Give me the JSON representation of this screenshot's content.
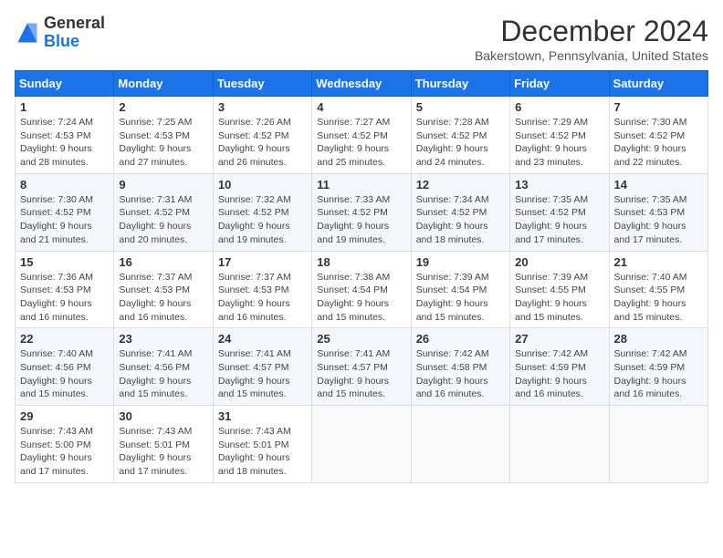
{
  "header": {
    "logo_general": "General",
    "logo_blue": "Blue",
    "title": "December 2024",
    "location": "Bakerstown, Pennsylvania, United States"
  },
  "columns": [
    "Sunday",
    "Monday",
    "Tuesday",
    "Wednesday",
    "Thursday",
    "Friday",
    "Saturday"
  ],
  "weeks": [
    [
      {
        "day": "1",
        "sunrise": "7:24 AM",
        "sunset": "4:53 PM",
        "daylight": "9 hours and 28 minutes."
      },
      {
        "day": "2",
        "sunrise": "7:25 AM",
        "sunset": "4:53 PM",
        "daylight": "9 hours and 27 minutes."
      },
      {
        "day": "3",
        "sunrise": "7:26 AM",
        "sunset": "4:52 PM",
        "daylight": "9 hours and 26 minutes."
      },
      {
        "day": "4",
        "sunrise": "7:27 AM",
        "sunset": "4:52 PM",
        "daylight": "9 hours and 25 minutes."
      },
      {
        "day": "5",
        "sunrise": "7:28 AM",
        "sunset": "4:52 PM",
        "daylight": "9 hours and 24 minutes."
      },
      {
        "day": "6",
        "sunrise": "7:29 AM",
        "sunset": "4:52 PM",
        "daylight": "9 hours and 23 minutes."
      },
      {
        "day": "7",
        "sunrise": "7:30 AM",
        "sunset": "4:52 PM",
        "daylight": "9 hours and 22 minutes."
      }
    ],
    [
      {
        "day": "8",
        "sunrise": "7:30 AM",
        "sunset": "4:52 PM",
        "daylight": "9 hours and 21 minutes."
      },
      {
        "day": "9",
        "sunrise": "7:31 AM",
        "sunset": "4:52 PM",
        "daylight": "9 hours and 20 minutes."
      },
      {
        "day": "10",
        "sunrise": "7:32 AM",
        "sunset": "4:52 PM",
        "daylight": "9 hours and 19 minutes."
      },
      {
        "day": "11",
        "sunrise": "7:33 AM",
        "sunset": "4:52 PM",
        "daylight": "9 hours and 19 minutes."
      },
      {
        "day": "12",
        "sunrise": "7:34 AM",
        "sunset": "4:52 PM",
        "daylight": "9 hours and 18 minutes."
      },
      {
        "day": "13",
        "sunrise": "7:35 AM",
        "sunset": "4:52 PM",
        "daylight": "9 hours and 17 minutes."
      },
      {
        "day": "14",
        "sunrise": "7:35 AM",
        "sunset": "4:53 PM",
        "daylight": "9 hours and 17 minutes."
      }
    ],
    [
      {
        "day": "15",
        "sunrise": "7:36 AM",
        "sunset": "4:53 PM",
        "daylight": "9 hours and 16 minutes."
      },
      {
        "day": "16",
        "sunrise": "7:37 AM",
        "sunset": "4:53 PM",
        "daylight": "9 hours and 16 minutes."
      },
      {
        "day": "17",
        "sunrise": "7:37 AM",
        "sunset": "4:53 PM",
        "daylight": "9 hours and 16 minutes."
      },
      {
        "day": "18",
        "sunrise": "7:38 AM",
        "sunset": "4:54 PM",
        "daylight": "9 hours and 15 minutes."
      },
      {
        "day": "19",
        "sunrise": "7:39 AM",
        "sunset": "4:54 PM",
        "daylight": "9 hours and 15 minutes."
      },
      {
        "day": "20",
        "sunrise": "7:39 AM",
        "sunset": "4:55 PM",
        "daylight": "9 hours and 15 minutes."
      },
      {
        "day": "21",
        "sunrise": "7:40 AM",
        "sunset": "4:55 PM",
        "daylight": "9 hours and 15 minutes."
      }
    ],
    [
      {
        "day": "22",
        "sunrise": "7:40 AM",
        "sunset": "4:56 PM",
        "daylight": "9 hours and 15 minutes."
      },
      {
        "day": "23",
        "sunrise": "7:41 AM",
        "sunset": "4:56 PM",
        "daylight": "9 hours and 15 minutes."
      },
      {
        "day": "24",
        "sunrise": "7:41 AM",
        "sunset": "4:57 PM",
        "daylight": "9 hours and 15 minutes."
      },
      {
        "day": "25",
        "sunrise": "7:41 AM",
        "sunset": "4:57 PM",
        "daylight": "9 hours and 15 minutes."
      },
      {
        "day": "26",
        "sunrise": "7:42 AM",
        "sunset": "4:58 PM",
        "daylight": "9 hours and 16 minutes."
      },
      {
        "day": "27",
        "sunrise": "7:42 AM",
        "sunset": "4:59 PM",
        "daylight": "9 hours and 16 minutes."
      },
      {
        "day": "28",
        "sunrise": "7:42 AM",
        "sunset": "4:59 PM",
        "daylight": "9 hours and 16 minutes."
      }
    ],
    [
      {
        "day": "29",
        "sunrise": "7:43 AM",
        "sunset": "5:00 PM",
        "daylight": "9 hours and 17 minutes."
      },
      {
        "day": "30",
        "sunrise": "7:43 AM",
        "sunset": "5:01 PM",
        "daylight": "9 hours and 17 minutes."
      },
      {
        "day": "31",
        "sunrise": "7:43 AM",
        "sunset": "5:01 PM",
        "daylight": "9 hours and 18 minutes."
      },
      null,
      null,
      null,
      null
    ]
  ],
  "labels": {
    "sunrise": "Sunrise:",
    "sunset": "Sunset:",
    "daylight": "Daylight:"
  }
}
